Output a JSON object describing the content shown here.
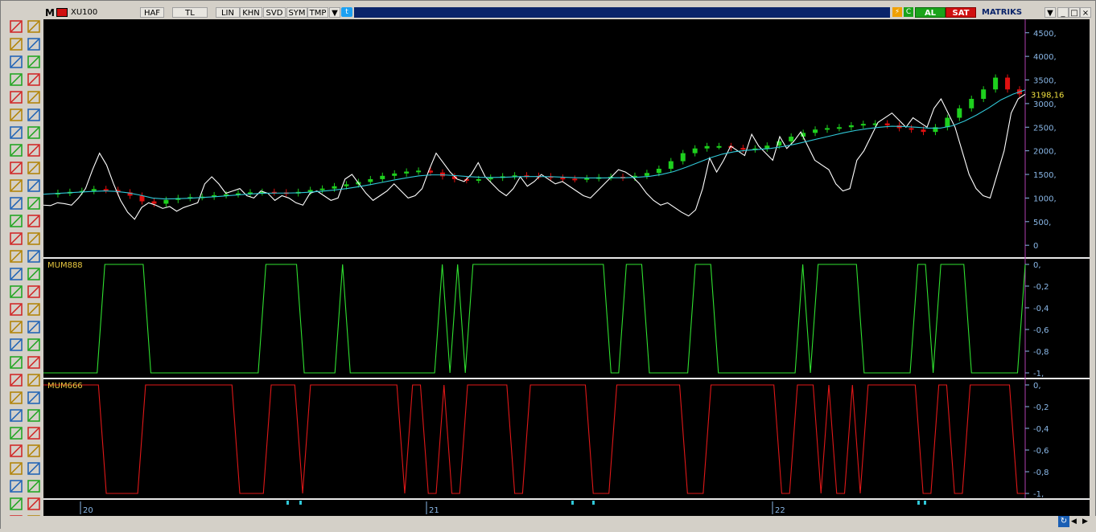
{
  "window": {
    "symbol": "XU100",
    "buttons": [
      "HAF",
      "TL",
      "LIN",
      "KHN",
      "SVD",
      "SYM",
      "TMP"
    ],
    "right": {
      "al": "AL",
      "sat": "SAT",
      "brand": "MATRIKS"
    },
    "colors": {
      "buy": "#1aa31a",
      "sell": "#d01010"
    }
  },
  "toolbar": {
    "icons": [
      "pattern-icon",
      "lock-icon",
      "list-icon",
      "cursor-icon",
      "bars-icon",
      "crosshair-icon",
      "trendline-icon",
      "pencil-icon",
      "fibonacci-icon",
      "pitchfork-icon",
      "channel-icon",
      "ruler-icon",
      "text-icon",
      "arrow-icon",
      "marker-icon",
      "up-arrow-icon",
      "bell-icon",
      "move-icon",
      "cross-icon",
      "minus-icon",
      "expand-icon",
      "vertical-line-icon",
      "resize-icon",
      "horizontal-icon",
      "collapse-icon",
      "bracket-icon",
      "zoom-fit-icon",
      "diagonal-icon",
      "multiply-icon",
      "dots-icon",
      "left-arrow-icon",
      "hatch-icon",
      "right-arrow-icon",
      "paint-icon",
      "up-icon",
      "grid-icon",
      "down-icon",
      "grid2-icon",
      "zoom-in-icon",
      "fan-icon",
      "zoom-out-icon",
      "columns-icon",
      "chart-icon",
      "scissors-icon",
      "triangle-icon",
      "grid3-icon",
      "magnet-icon",
      "grid4-icon",
      "blank-icon",
      "wave-icon",
      "blank2-icon",
      "wave2-icon",
      "blank3-icon",
      "angle-icon",
      "blank4-icon",
      "fan2-icon",
      "blank5-icon",
      "fan3-icon"
    ]
  },
  "chart_data": [
    {
      "type": "line",
      "panel": "price",
      "last_price_label": "3198,16",
      "y_ticks": [
        "4500,",
        "4000,",
        "3500,",
        "3000,",
        "2500,",
        "2000,",
        "1500,",
        "1000,",
        "500,",
        "0"
      ],
      "ylim": [
        -150,
        4700
      ],
      "x_ticks": [
        "20",
        "21",
        "22"
      ],
      "series": [
        {
          "key": "close",
          "values": [
            1080,
            1110,
            1130,
            1150,
            1190,
            1170,
            1120,
            1050,
            930,
            880,
            960,
            1000,
            1020,
            1030,
            1060,
            1080,
            1100,
            1120,
            1130,
            1120,
            1100,
            1130,
            1170,
            1200,
            1250,
            1290,
            1340,
            1400,
            1470,
            1520,
            1560,
            1580,
            1540,
            1460,
            1400,
            1380,
            1400,
            1430,
            1460,
            1480,
            1470,
            1460,
            1430,
            1410,
            1400,
            1420,
            1440,
            1450,
            1430,
            1470,
            1530,
            1620,
            1780,
            1950,
            2050,
            2100,
            2100,
            2060,
            2030,
            2050,
            2110,
            2200,
            2300,
            2380,
            2450,
            2480,
            2500,
            2540,
            2570,
            2580,
            2540,
            2480,
            2450,
            2400,
            2500,
            2700,
            2900,
            3100,
            3300,
            3550,
            3300,
            3198
          ]
        },
        {
          "key": "ma",
          "values": [
            1080,
            1095,
            1110,
            1125,
            1140,
            1150,
            1140,
            1110,
            1060,
            1000,
            980,
            985,
            995,
            1010,
            1025,
            1045,
            1065,
            1085,
            1100,
            1105,
            1105,
            1110,
            1125,
            1145,
            1170,
            1200,
            1240,
            1285,
            1335,
            1385,
            1430,
            1470,
            1490,
            1490,
            1475,
            1455,
            1440,
            1435,
            1440,
            1450,
            1455,
            1455,
            1450,
            1440,
            1430,
            1425,
            1425,
            1430,
            1430,
            1440,
            1460,
            1500,
            1560,
            1650,
            1750,
            1850,
            1930,
            1980,
            2010,
            2030,
            2050,
            2090,
            2140,
            2200,
            2260,
            2320,
            2380,
            2430,
            2470,
            2500,
            2520,
            2515,
            2500,
            2480,
            2480,
            2530,
            2630,
            2760,
            2910,
            3080,
            3200,
            3290
          ]
        },
        {
          "key": "mum",
          "values": [
            850,
            840,
            900,
            880,
            850,
            1000,
            1200,
            1600,
            1950,
            1700,
            1300,
            950,
            700,
            550,
            800,
            900,
            850,
            780,
            820,
            720,
            800,
            850,
            900,
            1300,
            1450,
            1300,
            1100,
            1150,
            1200,
            1050,
            1000,
            1150,
            1100,
            950,
            1050,
            1000,
            900,
            850,
            1100,
            1150,
            1050,
            950,
            1000,
            1400,
            1500,
            1300,
            1100,
            950,
            1050,
            1150,
            1300,
            1150,
            1000,
            1050,
            1200,
            1600,
            1950,
            1750,
            1550,
            1400,
            1350,
            1500,
            1750,
            1450,
            1300,
            1150,
            1050,
            1200,
            1450,
            1250,
            1350,
            1500,
            1400,
            1300,
            1350,
            1250,
            1150,
            1050,
            1000,
            1150,
            1300,
            1450,
            1600,
            1550,
            1450,
            1300,
            1100,
            950,
            850,
            900,
            800,
            700,
            620,
            750,
            1200,
            1850,
            1550,
            1800,
            2100,
            2000,
            1900,
            2350,
            2100,
            1950,
            1800,
            2300,
            2050,
            2200,
            2400,
            2100,
            1800,
            1700,
            1600,
            1300,
            1150,
            1200,
            1800,
            2000,
            2300,
            2600,
            2700,
            2800,
            2650,
            2500,
            2700,
            2600,
            2500,
            2900,
            3100,
            2800,
            2500,
            2000,
            1500,
            1200,
            1050,
            1000,
            1500,
            2000,
            2800,
            3100,
            3200
          ]
        }
      ]
    },
    {
      "type": "line",
      "panel": "MUM888",
      "name": "MUM888",
      "y_ticks": [
        "0,",
        "-0,2",
        "-0,4",
        "-0,6",
        "-0,8",
        "-1,"
      ],
      "ylim": [
        -1,
        0
      ],
      "series": [
        {
          "name": "MUM888",
          "values": [
            -1,
            -1,
            -1,
            -1,
            -1,
            -1,
            -1,
            -1,
            0,
            0,
            0,
            0,
            0,
            0,
            -1,
            -1,
            -1,
            -1,
            -1,
            -1,
            -1,
            -1,
            -1,
            -1,
            -1,
            -1,
            -1,
            -1,
            -1,
            0,
            0,
            0,
            0,
            0,
            -1,
            -1,
            -1,
            -1,
            -1,
            0,
            -1,
            -1,
            -1,
            -1,
            -1,
            -1,
            -1,
            -1,
            -1,
            -1,
            -1,
            -1,
            0,
            -1,
            0,
            -1,
            0,
            0,
            0,
            0,
            0,
            0,
            0,
            0,
            0,
            0,
            0,
            0,
            0,
            0,
            0,
            0,
            0,
            0,
            -1,
            -1,
            0,
            0,
            0,
            -1,
            -1,
            -1,
            -1,
            -1,
            -1,
            0,
            0,
            0,
            -1,
            -1,
            -1,
            -1,
            -1,
            -1,
            -1,
            -1,
            -1,
            -1,
            -1,
            0,
            -1,
            0,
            0,
            0,
            0,
            0,
            0,
            -1,
            -1,
            -1,
            -1,
            -1,
            -1,
            -1,
            0,
            0,
            -1,
            0,
            0,
            0,
            0,
            -1,
            -1,
            -1,
            -1,
            -1,
            -1,
            -1,
            0
          ]
        }
      ]
    },
    {
      "type": "line",
      "panel": "MUM666",
      "name": "MUM666",
      "y_ticks": [
        "0,",
        "-0,2",
        "-0,4",
        "-0,6",
        "-0,8",
        "-1,"
      ],
      "ylim": [
        -1,
        0
      ],
      "series": [
        {
          "name": "MUM666",
          "values": [
            0,
            0,
            0,
            0,
            0,
            0,
            0,
            0,
            -1,
            -1,
            -1,
            -1,
            -1,
            0,
            0,
            0,
            0,
            0,
            0,
            0,
            0,
            0,
            0,
            0,
            0,
            -1,
            -1,
            -1,
            -1,
            0,
            0,
            0,
            0,
            -1,
            0,
            0,
            0,
            0,
            0,
            0,
            0,
            0,
            0,
            0,
            0,
            0,
            -1,
            0,
            0,
            -1,
            -1,
            0,
            -1,
            -1,
            0,
            0,
            0,
            0,
            0,
            0,
            -1,
            -1,
            0,
            0,
            0,
            0,
            0,
            0,
            0,
            0,
            -1,
            -1,
            -1,
            0,
            0,
            0,
            0,
            0,
            0,
            0,
            0,
            0,
            -1,
            -1,
            -1,
            0,
            0,
            0,
            0,
            0,
            0,
            0,
            0,
            0,
            -1,
            -1,
            0,
            0,
            0,
            -1,
            0,
            -1,
            -1,
            0,
            -1,
            0,
            0,
            0,
            0,
            0,
            0,
            0,
            -1,
            -1,
            0,
            0,
            -1,
            -1,
            0,
            0,
            0,
            0,
            0,
            0,
            -1,
            -1
          ]
        }
      ]
    }
  ]
}
